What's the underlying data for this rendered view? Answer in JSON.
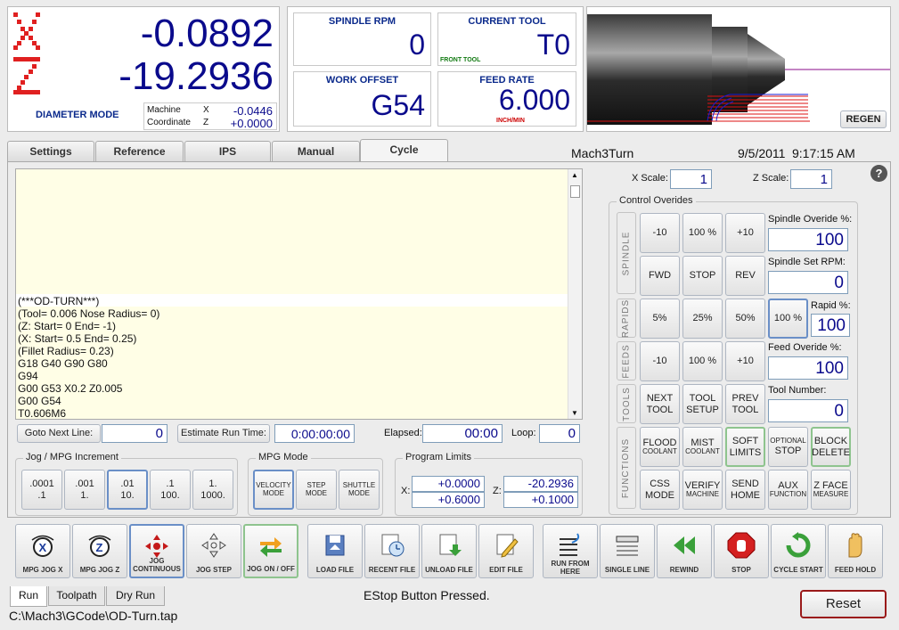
{
  "dro": {
    "x_letter": "X",
    "z_letter": "Z",
    "x_value": "-0.0892",
    "z_value": "-19.2936",
    "mode": "DIAMETER MODE",
    "machine_label": "Machine",
    "coordinate_label": "Coordinate",
    "mx": "X",
    "mz": "Z",
    "machine_x": "-0.0446",
    "machine_z": "+0.0000"
  },
  "status": {
    "spindle_rpm_label": "SPINDLE RPM",
    "spindle_rpm": "0",
    "current_tool_label": "CURRENT TOOL",
    "current_tool": "T0",
    "front_tool": "FRONT TOOL",
    "work_offset_label": "WORK OFFSET",
    "work_offset": "G54",
    "feed_rate_label": "FEED RATE",
    "feed_rate": "6.000",
    "feed_unit": "INCH/MIN"
  },
  "preview": {
    "regen": "REGEN"
  },
  "tabs": [
    "Settings",
    "Reference",
    "IPS",
    "Manual",
    "Cycle"
  ],
  "header": {
    "app": "Mach3Turn",
    "date": "9/5/2011",
    "time": "9:17:15 AM"
  },
  "gcode": [
    "(***OD-TURN***)",
    "(Tool= 0.006  Nose Radius= 0)",
    "(Z: Start= 0 End= -1)",
    "(X: Start= 0.5 End= 0.25)",
    "(Fillet Radius= 0.23)",
    "G18 G40 G90 G80",
    "G94",
    "G00 G53 X0.2 Z0.005",
    "G00 G54",
    "T0.606M6"
  ],
  "controls": {
    "goto_label": "Goto Next Line:",
    "goto_value": "0",
    "estimate_label": "Estimate Run Time:",
    "estimate_value": "0:00:00:00",
    "elapsed_label": "Elapsed:",
    "elapsed_value": "00:00",
    "loop_label": "Loop:",
    "loop_value": "0"
  },
  "jog": {
    "title": "Jog / MPG Increment",
    "incs": [
      [
        ".0001",
        ".1"
      ],
      [
        ".001",
        "1."
      ],
      [
        ".01",
        "10."
      ],
      [
        ".1",
        "100."
      ],
      [
        "1.",
        "1000."
      ]
    ]
  },
  "mpg": {
    "title": "MPG Mode",
    "modes": [
      [
        "VELOCITY",
        "MODE"
      ],
      [
        "STEP",
        "MODE"
      ],
      [
        "SHUTTLE",
        "MODE"
      ]
    ]
  },
  "limits": {
    "title": "Program Limits",
    "x": "X:",
    "z": "Z:",
    "xmin": "+0.0000",
    "xmax": "+0.6000",
    "zmin": "-20.2936",
    "zmax": "+0.1000"
  },
  "scale": {
    "x_label": "X Scale:",
    "x": "1",
    "z_label": "Z Scale:",
    "z": "1",
    "help": "?"
  },
  "overrides": {
    "title": "Control Overides",
    "sections": [
      "SPINDLE",
      "RAPIDS",
      "FEEDS",
      "TOOLS",
      "FUNCTIONS"
    ],
    "spindle": [
      "-10",
      "100 %",
      "+10",
      "FWD",
      "STOP",
      "REV"
    ],
    "rapids": [
      "5%",
      "25%",
      "50%",
      "100 %"
    ],
    "feeds": [
      "-10",
      "100 %",
      "+10"
    ],
    "tools": [
      [
        "NEXT",
        "TOOL"
      ],
      [
        "TOOL",
        "SETUP"
      ],
      [
        "PREV",
        "TOOL"
      ]
    ],
    "functions": [
      [
        "FLOOD",
        "COOLANT"
      ],
      [
        "MIST",
        "COOLANT"
      ],
      [
        "SOFT",
        "LIMITS"
      ],
      [
        "OPTIONAL",
        "STOP"
      ],
      [
        "BLOCK",
        "DELETE"
      ],
      [
        "CSS",
        "MODE"
      ],
      [
        "VERIFY",
        "MACHINE"
      ],
      [
        "SEND",
        "HOME"
      ],
      [
        "AUX",
        "FUNCTION"
      ],
      [
        "Z FACE",
        "MEASURE"
      ]
    ],
    "spindle_ov_label": "Spindle Overide %:",
    "spindle_ov": "100",
    "spindle_set_label": "Spindle Set RPM:",
    "spindle_set": "0",
    "rapid_label": "Rapid %:",
    "rapid": "100",
    "feed_ov_label": "Feed Overide %:",
    "feed_ov": "100",
    "tool_num_label": "Tool Number:",
    "tool_num": "0"
  },
  "bottom_buttons": [
    "MPG JOG X",
    "MPG JOG Z",
    "JOG CONTINUOUS",
    "JOG STEP",
    "JOG ON / OFF",
    "LOAD FILE",
    "RECENT FILE",
    "UNLOAD FILE",
    "EDIT FILE",
    "RUN FROM HERE",
    "SINGLE LINE",
    "REWIND",
    "STOP",
    "CYCLE START",
    "FEED HOLD"
  ],
  "bottom_tabs": [
    "Run",
    "Toolpath",
    "Dry Run"
  ],
  "status_msg": "EStop Button Pressed.",
  "reset": "Reset",
  "file_path": "C:\\Mach3\\GCode\\OD-Turn.tap",
  "colors": {
    "dro_letter": "#e02020",
    "value": "#0a0a8c",
    "label_blue": "#0b2a8c",
    "feed_unit": "#cc0000"
  }
}
